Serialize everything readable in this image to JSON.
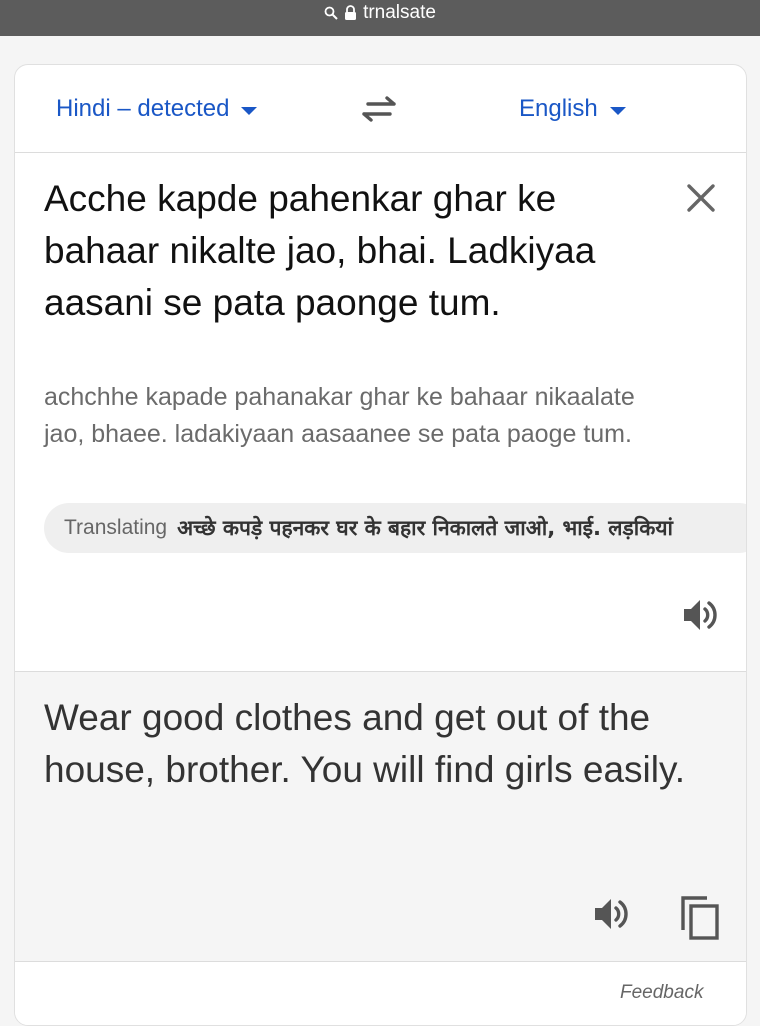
{
  "browser": {
    "url": "trnalsate"
  },
  "languages": {
    "source": "Hindi – detected",
    "target": "English"
  },
  "source": {
    "text": "Acche kapde pahenkar ghar ke bahaar nikalte jao, bhai. Ladkiyaa aasani se pata paonge tum.",
    "transliteration": "achchhe kapade pahanakar ghar ke bahaar nikaalate jao, bhaee. ladakiyaan aasaanee se pata paoge tum.",
    "translating_label": "Translating",
    "translating_text": "अच्छे कपड़े पहनकर घर के बहार निकालते जाओ, भाई. लड़कियां"
  },
  "target": {
    "text": "Wear good clothes and get out of the house, brother. You will find girls easily."
  },
  "footer": {
    "feedback": "Feedback"
  },
  "icons": {
    "search": "search-icon",
    "lock": "lock-icon",
    "swap": "swap-icon",
    "close": "close-icon",
    "speaker": "speaker-icon",
    "copy": "copy-icon"
  },
  "colors": {
    "accent": "#1a57c6",
    "url_bar": "#5c5c5c"
  }
}
